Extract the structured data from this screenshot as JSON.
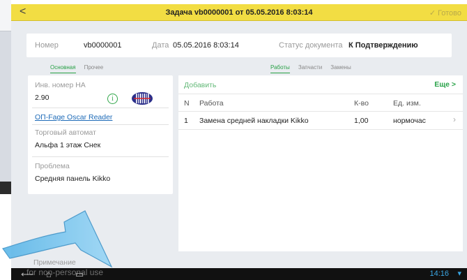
{
  "header": {
    "back": "<",
    "title": "Задача vb0000001 от 05.05.2016 8:03:14",
    "done": "Готово",
    "done_icon": "pencil-check-icon"
  },
  "info": {
    "number_label": "Номер",
    "number_value": "vb0000001",
    "date_label": "Дата",
    "date_value": "05.05.2016 8:03:14",
    "status_label": "Статус документа",
    "status_value": "К Подтверждению"
  },
  "tabs_left": [
    {
      "label": "Основная",
      "active": true
    },
    {
      "label": "Прочее",
      "active": false
    }
  ],
  "tabs_right": [
    {
      "label": "Работы",
      "active": true
    },
    {
      "label": "Запчасти",
      "active": false
    },
    {
      "label": "Замены",
      "active": false
    }
  ],
  "fields": {
    "inv_label": "Инв. номер НА",
    "inv_value": "2.90",
    "model_link": "ОП-Fage Oscar Reader",
    "vending_label": "Торговый автомат",
    "vending_value": "Альфа 1 этаж Снек",
    "problem_label": "Проблема",
    "problem_value": "Средняя панель Kikko"
  },
  "works": {
    "add": "Добавить",
    "more": "Еще >",
    "columns": [
      "N",
      "Работа",
      "К-во",
      "Ед. изм."
    ],
    "rows": [
      {
        "n": "1",
        "work": "Замена средней накладки Kikko",
        "qty": "1,00",
        "unit": "нормочас"
      }
    ]
  },
  "note_label": "Примечание",
  "status_bar": {
    "time": "14:16",
    "signal_icon": "wifi-icon"
  },
  "watermark": "for non-personal use",
  "colors": {
    "topbar": "#f2dd43",
    "accent_green": "#28a045",
    "link_blue": "#1e6bb8",
    "arrow_blue": "#6cc0ec"
  }
}
